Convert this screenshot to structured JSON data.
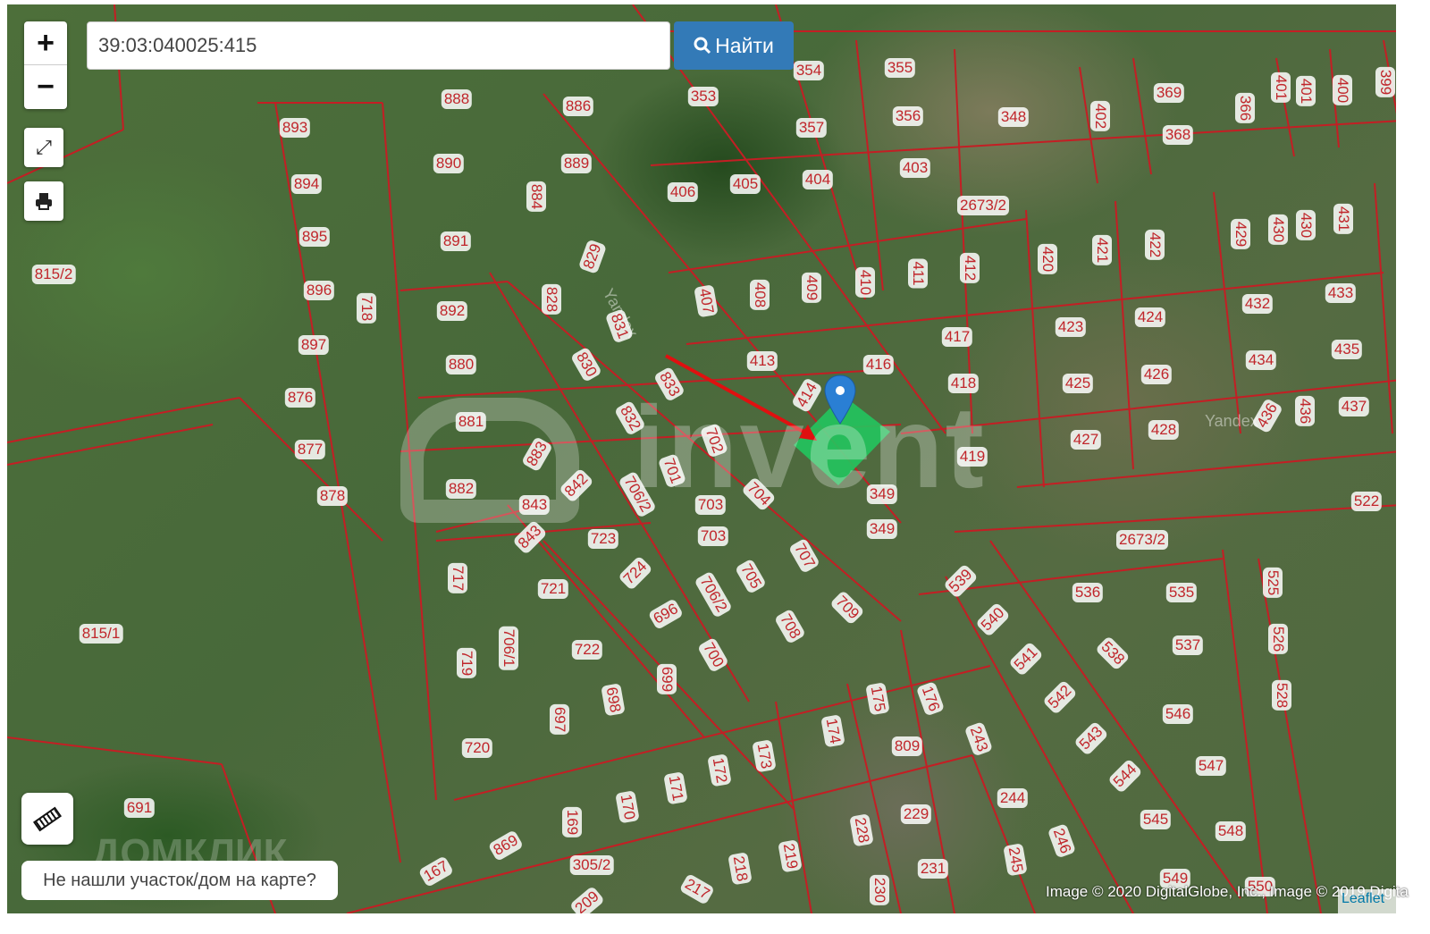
{
  "search": {
    "value": "39:03:040025:415",
    "button_label": "Найти"
  },
  "controls": {
    "zoom_in": "+",
    "zoom_out": "−"
  },
  "not_found_label": "Не нашли участок/дом на карте?",
  "attribution": "Image © 2020 DigitalGlobe, Inc., Image © 2019 Digita",
  "leaflet_label": "Leaflet",
  "watermarks": {
    "invent": "invent",
    "domclick": "ДОМКЛИК",
    "yandex": "Yandex"
  },
  "colors": {
    "parcel_line": "#c0262b",
    "selected_parcel": "#22c55e",
    "pin": "#2a7fd4",
    "button": "#337ab7"
  },
  "parcels": [
    "893",
    "894",
    "895",
    "896",
    "897",
    "876",
    "877",
    "878",
    "815/2",
    "815/1",
    "718",
    "888",
    "886",
    "890",
    "889",
    "884",
    "891",
    "892",
    "880",
    "881",
    "882",
    "829",
    "828",
    "831",
    "830",
    "833",
    "832",
    "883",
    "843",
    "842",
    "843",
    "701",
    "702",
    "706/2",
    "704",
    "703",
    "703",
    "723",
    "724",
    "717",
    "721",
    "706/2",
    "705",
    "707",
    "709",
    "708",
    "696",
    "722",
    "700",
    "699",
    "719",
    "706/1",
    "698",
    "697",
    "720",
    "353",
    "354",
    "355",
    "357",
    "356",
    "348",
    "406",
    "405",
    "404",
    "403",
    "402",
    "369",
    "368",
    "366",
    "401",
    "401",
    "400",
    "399",
    "2673/2",
    "407",
    "408",
    "409",
    "410",
    "411",
    "412",
    "420",
    "421",
    "422",
    "429",
    "430",
    "430",
    "431",
    "413",
    "414",
    "416",
    "417",
    "418",
    "423",
    "424",
    "425",
    "426",
    "432",
    "433",
    "434",
    "435",
    "436",
    "436",
    "437",
    "427",
    "428",
    "419",
    "349",
    "349",
    "522",
    "2673/2",
    "539",
    "540",
    "536",
    "535",
    "525",
    "541",
    "538",
    "537",
    "526",
    "528",
    "542",
    "546",
    "543",
    "547",
    "544",
    "545",
    "548",
    "549",
    "550",
    "175",
    "176",
    "809",
    "243",
    "174",
    "173",
    "172",
    "171",
    "170",
    "169",
    "244",
    "229",
    "228",
    "246",
    "245",
    "231",
    "230",
    "219",
    "218",
    "217",
    "305/2",
    "869",
    "167",
    "209",
    "691"
  ]
}
